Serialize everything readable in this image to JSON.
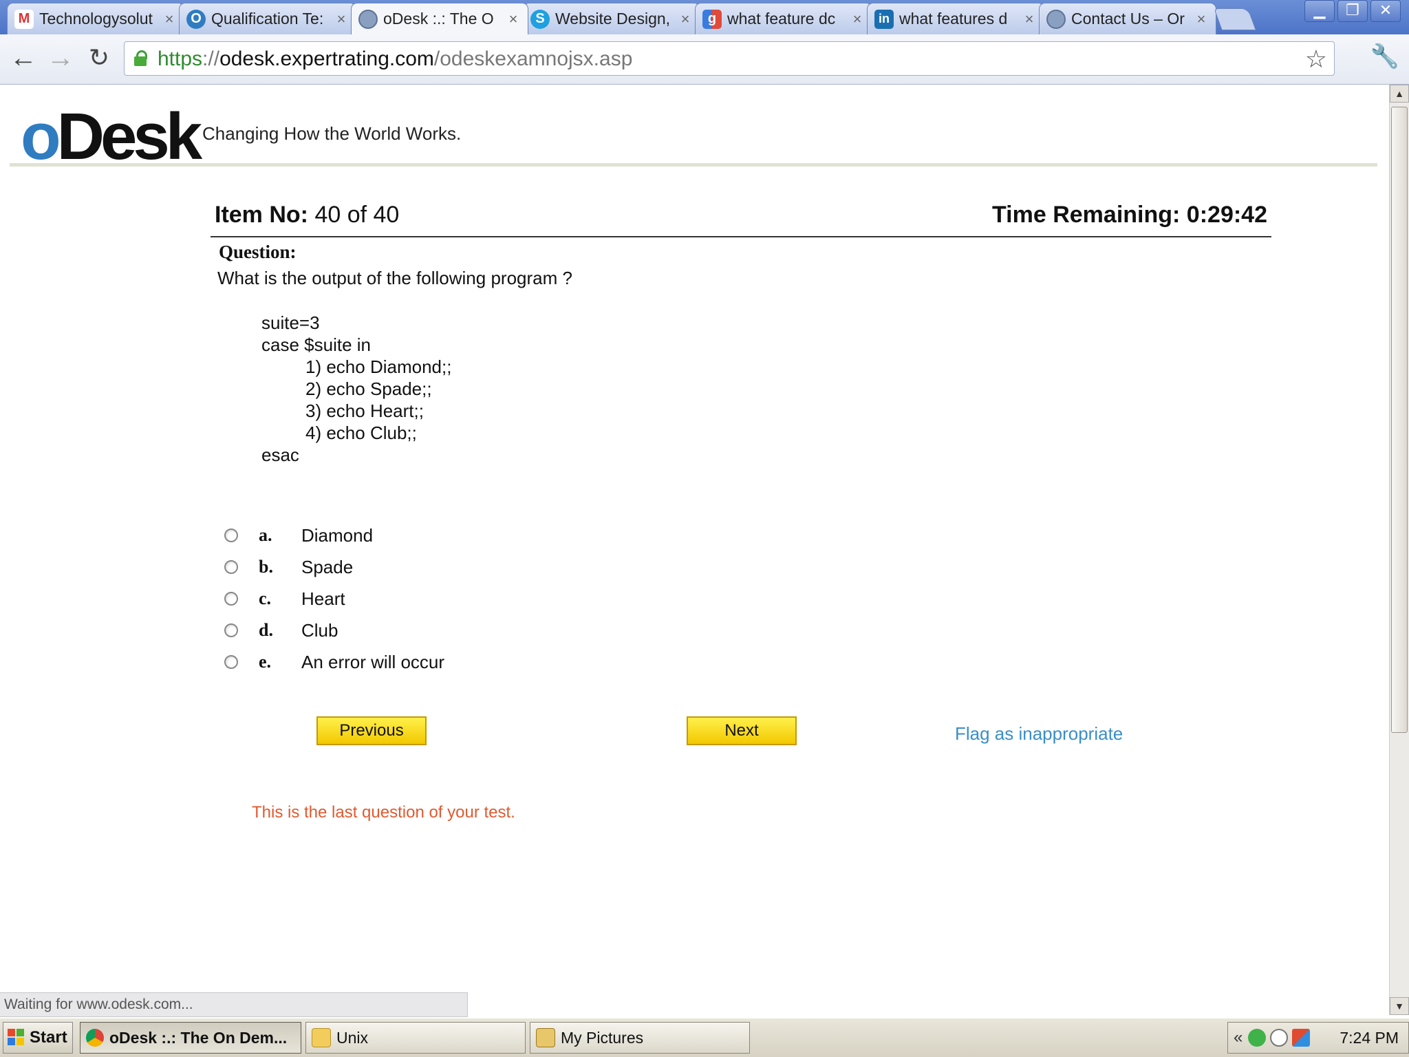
{
  "browser": {
    "tabs": [
      {
        "label": "Technologysolut",
        "icon": "gmail-icon",
        "active": false
      },
      {
        "label": "Qualification Te:",
        "icon": "odesk-icon",
        "active": false
      },
      {
        "label": "oDesk :.: The O",
        "icon": "globe-icon",
        "active": true
      },
      {
        "label": "Website Design,",
        "icon": "skype-icon",
        "active": false
      },
      {
        "label": "what feature dc",
        "icon": "google-icon",
        "active": false
      },
      {
        "label": "what features d",
        "icon": "linkedin-icon",
        "active": false
      },
      {
        "label": "Contact Us – Or",
        "icon": "globe-icon",
        "active": false
      }
    ],
    "close_glyph": "×",
    "window_buttons": [
      "▁",
      "❐",
      "✕"
    ],
    "url": {
      "scheme": "https",
      "separator": "://",
      "host": "odesk.expertrating.com",
      "path": "/odeskexamnojsx.asp"
    }
  },
  "page": {
    "logo": {
      "o": "o",
      "rest": "Desk"
    },
    "tagline": "Changing How the World Works.",
    "item_label": "Item No:",
    "item_value": "40 of 40",
    "time_label": "Time Remaining:",
    "time_value": "0:29:42",
    "question_heading": "Question:",
    "question_text": "What is the output of the following program ?",
    "code_lines": [
      {
        "text": "suite=3",
        "indent": 0
      },
      {
        "text": "case $suite in",
        "indent": 0
      },
      {
        "text": "1) echo Diamond;;",
        "indent": 1
      },
      {
        "text": "2) echo Spade;;",
        "indent": 1
      },
      {
        "text": "3) echo Heart;;",
        "indent": 1
      },
      {
        "text": "4) echo Club;;",
        "indent": 1
      },
      {
        "text": "esac",
        "indent": 0
      }
    ],
    "options": [
      {
        "letter": "a.",
        "text": "Diamond"
      },
      {
        "letter": "b.",
        "text": "Spade"
      },
      {
        "letter": "c.",
        "text": "Heart"
      },
      {
        "letter": "d.",
        "text": "Club"
      },
      {
        "letter": "e.",
        "text": "An error will occur"
      }
    ],
    "previous_label": "Previous",
    "next_label": "Next",
    "flag_label": "Flag as inappropriate",
    "last_question_msg": "This is the last question of your test."
  },
  "status_text": "Waiting for www.odesk.com...",
  "taskbar": {
    "start_label": "Start",
    "tasks": [
      {
        "label": "oDesk :.: The On Dem...",
        "icon": "chrome-icon",
        "active": true
      },
      {
        "label": "Unix",
        "icon": "folder-icon",
        "active": false
      },
      {
        "label": "My Pictures",
        "icon": "pictures-folder-icon",
        "active": false
      }
    ],
    "tray_chevron": "«",
    "clock": "7:24 PM"
  },
  "colors": {
    "accent_blue": "#2f7cc1",
    "button_yellow": "#f2c800",
    "link_blue": "#3a8ec7",
    "warning_orange": "#e05a30",
    "https_green": "#2e8b2e"
  }
}
